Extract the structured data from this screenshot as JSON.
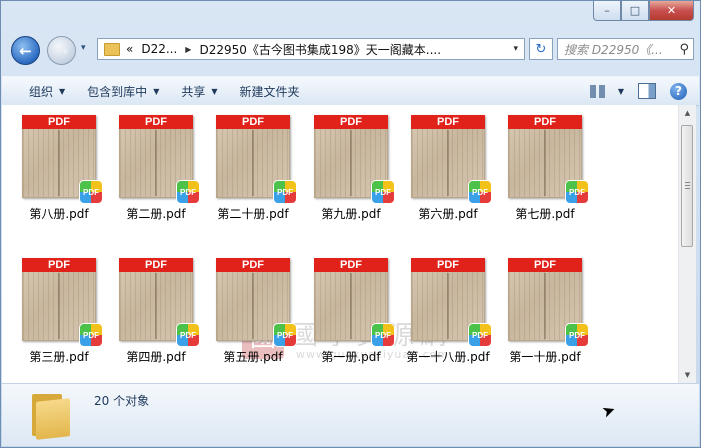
{
  "window": {
    "min_label": "–",
    "max_label": "□",
    "close_label": "✕"
  },
  "nav": {
    "back_icon": "←",
    "forward_icon": "→",
    "history_icon": "▾"
  },
  "address": {
    "overflow": "«",
    "crumb1": "D22...",
    "sep": "▶",
    "crumb2": "D22950《古今图书集成198》天一阁藏本....",
    "dropdown_icon": "▾",
    "refresh_icon": "↻"
  },
  "search": {
    "placeholder": "搜索 D22950《...",
    "icon": "⚲"
  },
  "toolbar": {
    "organize": "组织",
    "include": "包含到库中",
    "share": "共享",
    "new_folder": "新建文件夹",
    "caret": "▼",
    "help": "?"
  },
  "files": [
    "第八册.pdf",
    "第二册.pdf",
    "第二十册.pdf",
    "第九册.pdf",
    "第六册.pdf",
    "第七册.pdf",
    "第三册.pdf",
    "第四册.pdf",
    "第五册.pdf",
    "第一册.pdf",
    "第一十八册.pdf",
    "第一十册.pdf"
  ],
  "pdf_band": "PDF",
  "pdf_badge": "PDF",
  "watermark": {
    "seal": "國",
    "title": "國學資源網",
    "url": "www.guoxueziyuan.com"
  },
  "scrollbar": {
    "up": "▲",
    "down": "▼"
  },
  "status": {
    "count": "20 个对象"
  },
  "colors": {
    "pdf_red": "#e0221a",
    "window_frame": "#c6d8ec",
    "toolbar_text": "#1e395b"
  }
}
